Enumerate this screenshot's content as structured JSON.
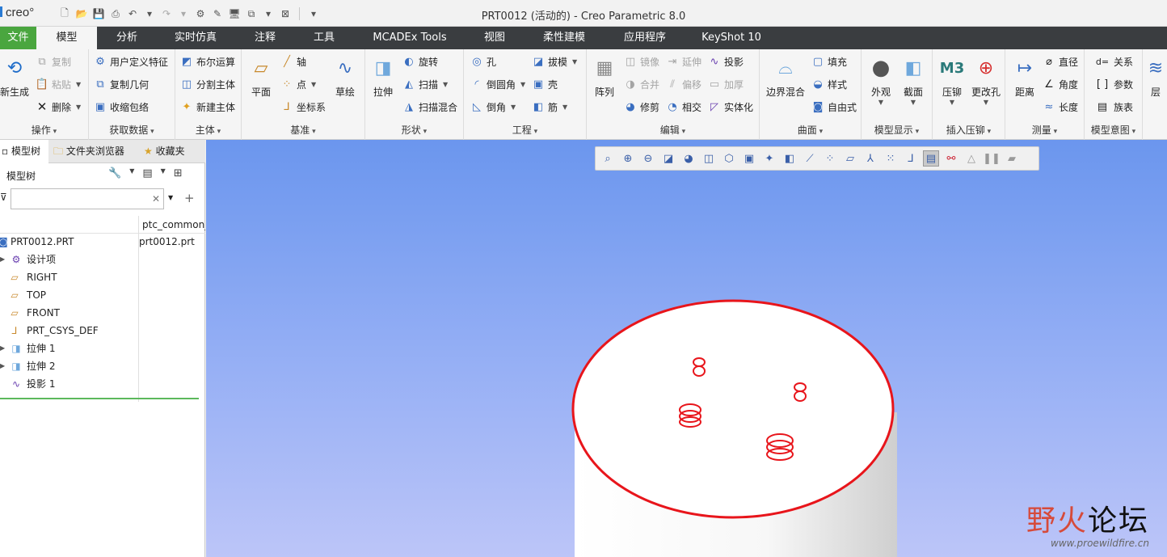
{
  "app": {
    "logo": "creo",
    "window_title": "PRT0012 (活动的) - Creo Parametric 8.0"
  },
  "tabs": [
    {
      "label": "文件"
    },
    {
      "label": "模型"
    },
    {
      "label": "分析"
    },
    {
      "label": "实时仿真"
    },
    {
      "label": "注释"
    },
    {
      "label": "工具"
    },
    {
      "label": "MCADEx Tools"
    },
    {
      "label": "视图"
    },
    {
      "label": "柔性建模"
    },
    {
      "label": "应用程序"
    },
    {
      "label": "KeyShot 10"
    }
  ],
  "ribbon": {
    "operations": {
      "name": "操作",
      "regenerate": "新生成",
      "copy": "复制",
      "paste": "粘贴",
      "delete": "删除"
    },
    "get_data": {
      "name": "获取数据",
      "udf": "用户定义特征",
      "copy_geom": "复制几何",
      "shrinkwrap": "收缩包络"
    },
    "body": {
      "name": "主体",
      "boolean": "布尔运算",
      "split": "分割主体",
      "new_body": "新建主体"
    },
    "datum": {
      "name": "基准",
      "plane": "平面",
      "axis": "轴",
      "point": "点",
      "csys": "坐标系",
      "sketch": "草绘"
    },
    "shapes": {
      "name": "形状",
      "extrude": "拉伸",
      "revolve": "旋转",
      "sweep": "扫描",
      "swept_blend": "扫描混合"
    },
    "engineering": {
      "name": "工程",
      "hole": "孔",
      "round": "倒圆角",
      "chamfer": "倒角",
      "draft": "拔模",
      "shell": "壳",
      "rib": "筋"
    },
    "editing": {
      "name": "编辑",
      "pattern": "阵列",
      "mirror": "镜像",
      "merge": "合并",
      "trim": "修剪",
      "extend": "延伸",
      "offset": "偏移",
      "intersect": "相交",
      "project": "投影",
      "thicken": "加厚",
      "solidify": "实体化"
    },
    "surfaces": {
      "name": "曲面",
      "boundary": "边界混合",
      "fill": "填充",
      "style": "样式",
      "freestyle": "自由式"
    },
    "model_display": {
      "name": "模型显示",
      "appearance": "外观",
      "section": "截面"
    },
    "insert_rivet": {
      "name": "插入压铆",
      "rivet": "压铆",
      "modify_hole": "更改孔"
    },
    "measure": {
      "name": "测量",
      "distance": "距离",
      "diameter": "直径",
      "angle": "角度",
      "length": "长度"
    },
    "model_intent": {
      "name": "模型意图",
      "relations": "关系",
      "parameters": "参数",
      "family": "族表"
    },
    "layers": {
      "label": "层"
    }
  },
  "panel": {
    "tabs": [
      "模型树",
      "文件夹浏览器",
      "收藏夹"
    ],
    "title": "模型树",
    "column_header": "ptc_common_name",
    "tree": [
      {
        "label": "PRT0012.PRT",
        "value": "prt0012.prt",
        "icon": "part-icon"
      },
      {
        "label": "设计项",
        "value": "",
        "icon": "design-items-icon"
      },
      {
        "label": "RIGHT",
        "value": "",
        "icon": "datum-plane-icon"
      },
      {
        "label": "TOP",
        "value": "",
        "icon": "datum-plane-icon"
      },
      {
        "label": "FRONT",
        "value": "",
        "icon": "datum-plane-icon"
      },
      {
        "label": "PRT_CSYS_DEF",
        "value": "",
        "icon": "csys-icon"
      },
      {
        "label": "拉伸 1",
        "value": "",
        "icon": "extrude-icon"
      },
      {
        "label": "拉伸 2",
        "value": "",
        "icon": "extrude-icon"
      },
      {
        "label": "投影 1",
        "value": "",
        "icon": "project-icon"
      }
    ]
  },
  "colors": {
    "selection": "#e8151b",
    "accent_green": "#4aa63f"
  },
  "watermark": {
    "main_a": "野火",
    "main_b": "论坛",
    "url": "www.proewildfire.cn"
  }
}
